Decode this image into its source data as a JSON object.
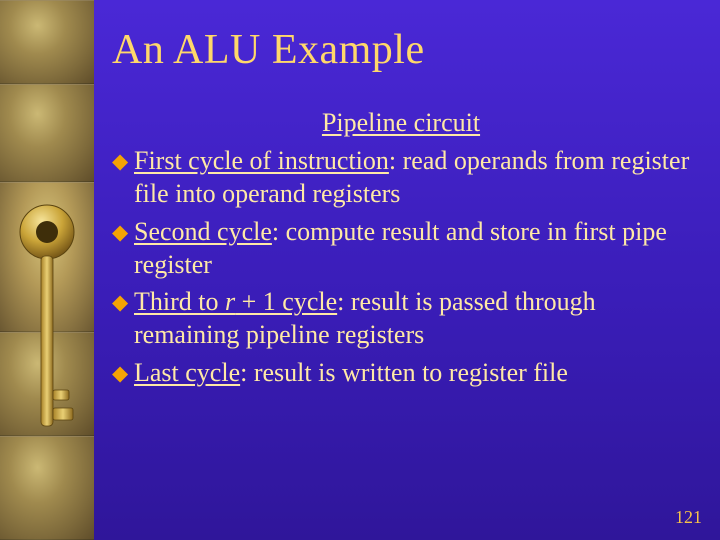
{
  "title": "An ALU Example",
  "subtitle": "Pipeline circuit",
  "bullets": [
    {
      "lead": "First cycle of instruction",
      "rest": ": read operands from register file into operand registers"
    },
    {
      "lead": "Second cycle",
      "rest": ": compute result and store in first pipe register"
    },
    {
      "lead_prefix": "Third to ",
      "lead_italic": "r",
      "lead_suffix": " + 1 cycle",
      "rest": ": result is passed through remaining pipeline registers"
    },
    {
      "lead": "Last cycle",
      "rest": ": result is written to register file"
    }
  ],
  "page_number": "121"
}
